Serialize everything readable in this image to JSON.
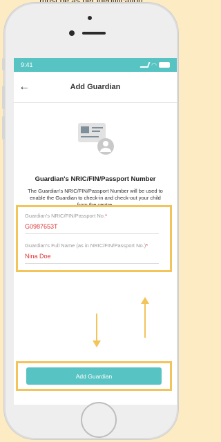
{
  "caption": "must be as per identification",
  "status_bar": {
    "time": "9:41"
  },
  "nav": {
    "back_icon": "back-arrow-icon",
    "title": "Add Guardian"
  },
  "heading": "Guardian's NRIC/FIN/Passport Number",
  "description": "The Guardian's NRIC/FIN/Passport Number will be used to enable the Guardian to check-in and check-out your child from the centre.",
  "form": {
    "id_field": {
      "label": "Guardian's NRIC/FIN/Passport No.",
      "required_mark": "*",
      "value": "G0987653T"
    },
    "name_field": {
      "label": "Guardian's Full Name (as in NRIC/FIN/Passport No.)",
      "required_mark": "*",
      "value": "Nina Doe"
    }
  },
  "primary_button": {
    "label": "Add Guardian"
  },
  "colors": {
    "accent": "#57c3c3",
    "highlight": "#f2c45a",
    "value_text": "#dd3333"
  }
}
